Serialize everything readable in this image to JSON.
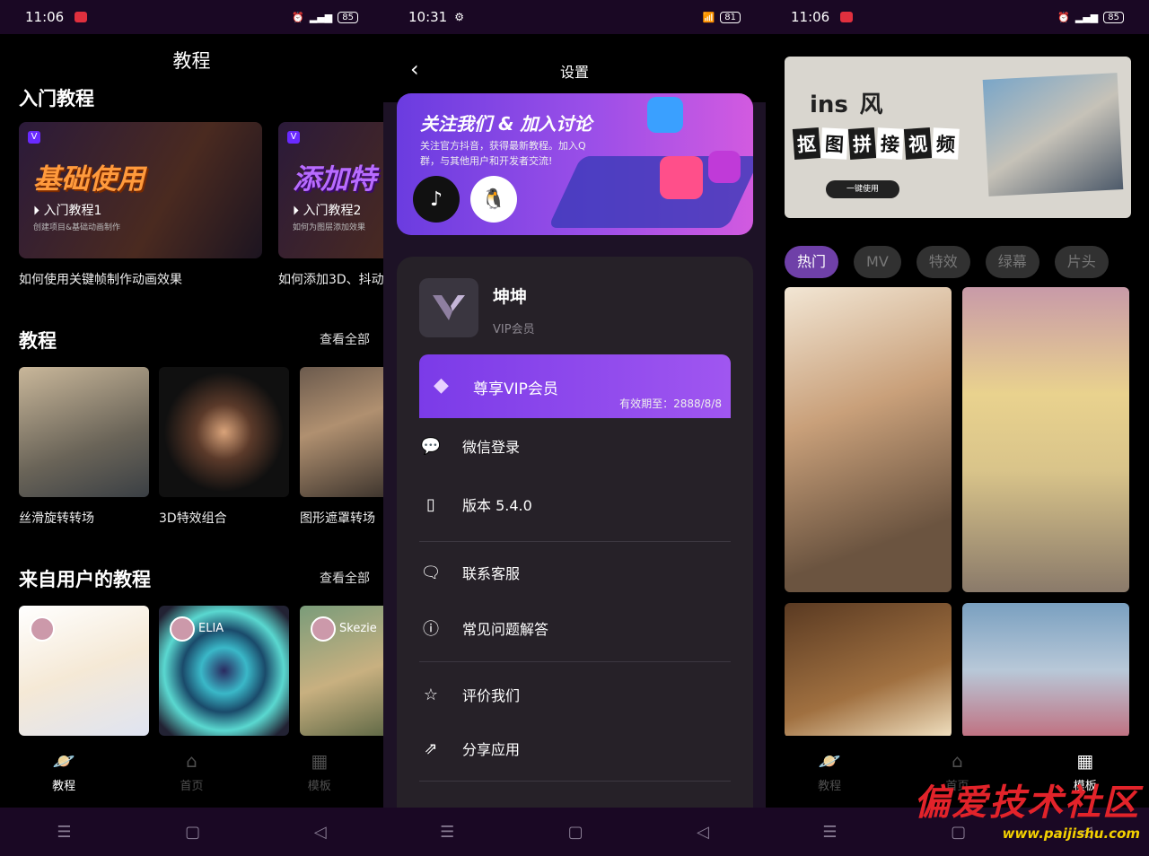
{
  "screen1": {
    "status": {
      "time": "11:06",
      "battery": "85"
    },
    "page_title": "教程",
    "intro_section": "入门教程",
    "banners": [
      {
        "big": "基础使用",
        "sub": "入门教程1",
        "sub2": "创建项目&基础动画制作",
        "caption": "如何使用关键帧制作动画效果"
      },
      {
        "big": "添加特",
        "sub": "入门教程2",
        "sub2": "如何为图层添加效果",
        "caption": "如何添加3D、抖动"
      }
    ],
    "tutorials_section": "教程",
    "see_all": "查看全部",
    "tutorials": [
      {
        "caption": "丝滑旋转转场"
      },
      {
        "caption": "3D特效组合"
      },
      {
        "caption": "图形遮罩转场"
      }
    ],
    "user_section": "来自用户的教程",
    "user_see_all": "查看全部",
    "user_tutorials": [
      {
        "name": ""
      },
      {
        "name": "ELIA"
      },
      {
        "name": "Skezie"
      }
    ],
    "tabs": [
      {
        "label": "教程"
      },
      {
        "label": "首页"
      },
      {
        "label": "模板"
      }
    ]
  },
  "screen2": {
    "status": {
      "time": "10:31",
      "battery": "81"
    },
    "title": "设置",
    "promo_title": "关注我们 & 加入讨论",
    "promo_desc": "关注官方抖音，获得最新教程。加入Q群，与其他用户和开发者交流!",
    "username": "坤坤",
    "role": "VIP会员",
    "vip_label": "尊享VIP会员",
    "vip_expiry": "有效期至：2888/8/8",
    "rows": [
      {
        "label": "微信登录",
        "icon": "wechat-icon"
      },
      {
        "label": "版本 5.4.0",
        "icon": "phone-icon"
      },
      {
        "label": "联系客服",
        "icon": "chat-icon"
      },
      {
        "label": "常见问题解答",
        "icon": "question-icon"
      },
      {
        "label": "评价我们",
        "icon": "star-icon"
      },
      {
        "label": "分享应用",
        "icon": "share-icon"
      }
    ]
  },
  "screen3": {
    "status": {
      "time": "11:06",
      "battery": "85"
    },
    "banner_title": "ins",
    "banner_title2": "风",
    "banner_chars": [
      "抠",
      "图",
      "拼",
      "接",
      "视",
      "频"
    ],
    "banner_btn": "一键使用",
    "chips": [
      "热门",
      "MV",
      "特效",
      "绿幕",
      "片头"
    ],
    "tabs": [
      {
        "label": "教程"
      },
      {
        "label": "首页"
      },
      {
        "label": "模板"
      }
    ],
    "watermark": "偏爱技术社区",
    "watermark_url": "www.paijishu.com"
  },
  "colors": {
    "accent": "#6f40a8",
    "vip": "#8a48ec",
    "bg": "#000000",
    "card": "#262128"
  }
}
